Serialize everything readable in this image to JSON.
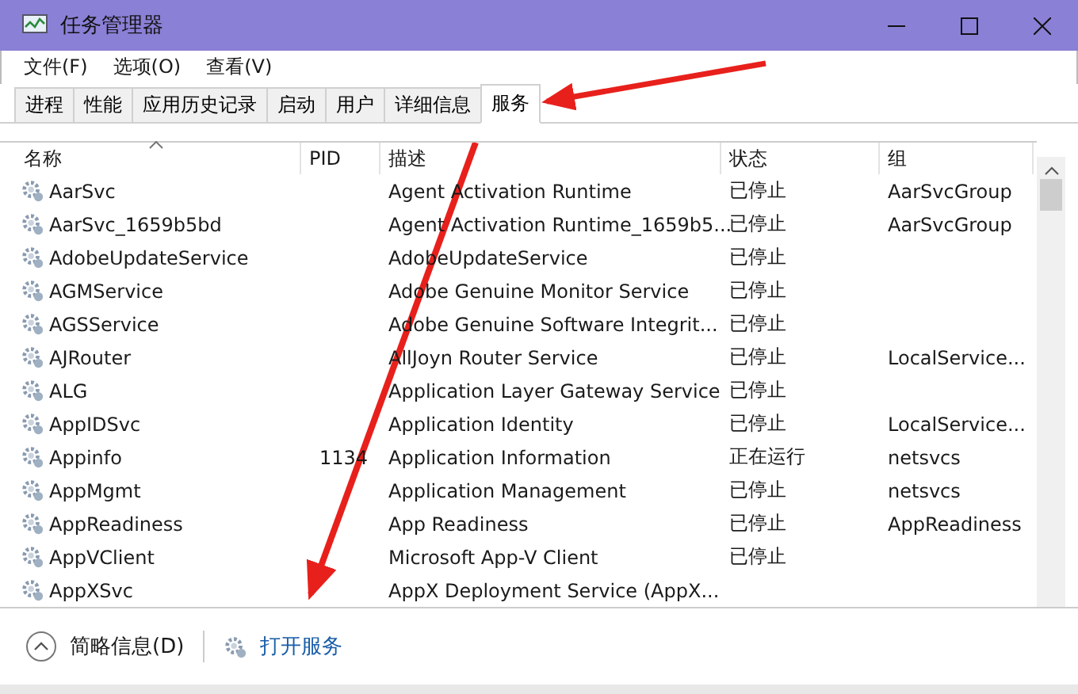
{
  "window": {
    "title": "任务管理器"
  },
  "menu": [
    "文件(F)",
    "选项(O)",
    "查看(V)"
  ],
  "tabs": [
    {
      "label": "进程",
      "selected": false
    },
    {
      "label": "性能",
      "selected": false
    },
    {
      "label": "应用历史记录",
      "selected": false
    },
    {
      "label": "启动",
      "selected": false
    },
    {
      "label": "用户",
      "selected": false
    },
    {
      "label": "详细信息",
      "selected": false
    },
    {
      "label": "服务",
      "selected": true
    }
  ],
  "table": {
    "columns": [
      "名称",
      "PID",
      "描述",
      "状态",
      "组"
    ],
    "rows": [
      {
        "name": "AarSvc",
        "pid": "",
        "description": "Agent Activation Runtime",
        "status": "已停止",
        "group": "AarSvcGroup"
      },
      {
        "name": "AarSvc_1659b5bd",
        "pid": "",
        "description": "Agent Activation Runtime_1659b5...",
        "status": "已停止",
        "group": "AarSvcGroup"
      },
      {
        "name": "AdobeUpdateService",
        "pid": "",
        "description": "AdobeUpdateService",
        "status": "已停止",
        "group": ""
      },
      {
        "name": "AGMService",
        "pid": "",
        "description": "Adobe Genuine Monitor Service",
        "status": "已停止",
        "group": ""
      },
      {
        "name": "AGSService",
        "pid": "",
        "description": "Adobe Genuine Software Integrit...",
        "status": "已停止",
        "group": ""
      },
      {
        "name": "AJRouter",
        "pid": "",
        "description": "AllJoyn Router Service",
        "status": "已停止",
        "group": "LocalService..."
      },
      {
        "name": "ALG",
        "pid": "",
        "description": "Application Layer Gateway Service",
        "status": "已停止",
        "group": ""
      },
      {
        "name": "AppIDSvc",
        "pid": "",
        "description": "Application Identity",
        "status": "已停止",
        "group": "LocalService..."
      },
      {
        "name": "Appinfo",
        "pid": "1134",
        "description": "Application Information",
        "status": "正在运行",
        "group": "netsvcs"
      },
      {
        "name": "AppMgmt",
        "pid": "",
        "description": "Application Management",
        "status": "已停止",
        "group": "netsvcs"
      },
      {
        "name": "AppReadiness",
        "pid": "",
        "description": "App Readiness",
        "status": "已停止",
        "group": "AppReadiness"
      },
      {
        "name": "AppVClient",
        "pid": "",
        "description": "Microsoft App-V Client",
        "status": "已停止",
        "group": ""
      },
      {
        "name": "AppXSvc",
        "pid": "",
        "description": "AppX Deployment Service (AppX...",
        "status": "",
        "group": ""
      }
    ]
  },
  "footer": {
    "details": "简略信息(D)",
    "link": "打开服务"
  }
}
